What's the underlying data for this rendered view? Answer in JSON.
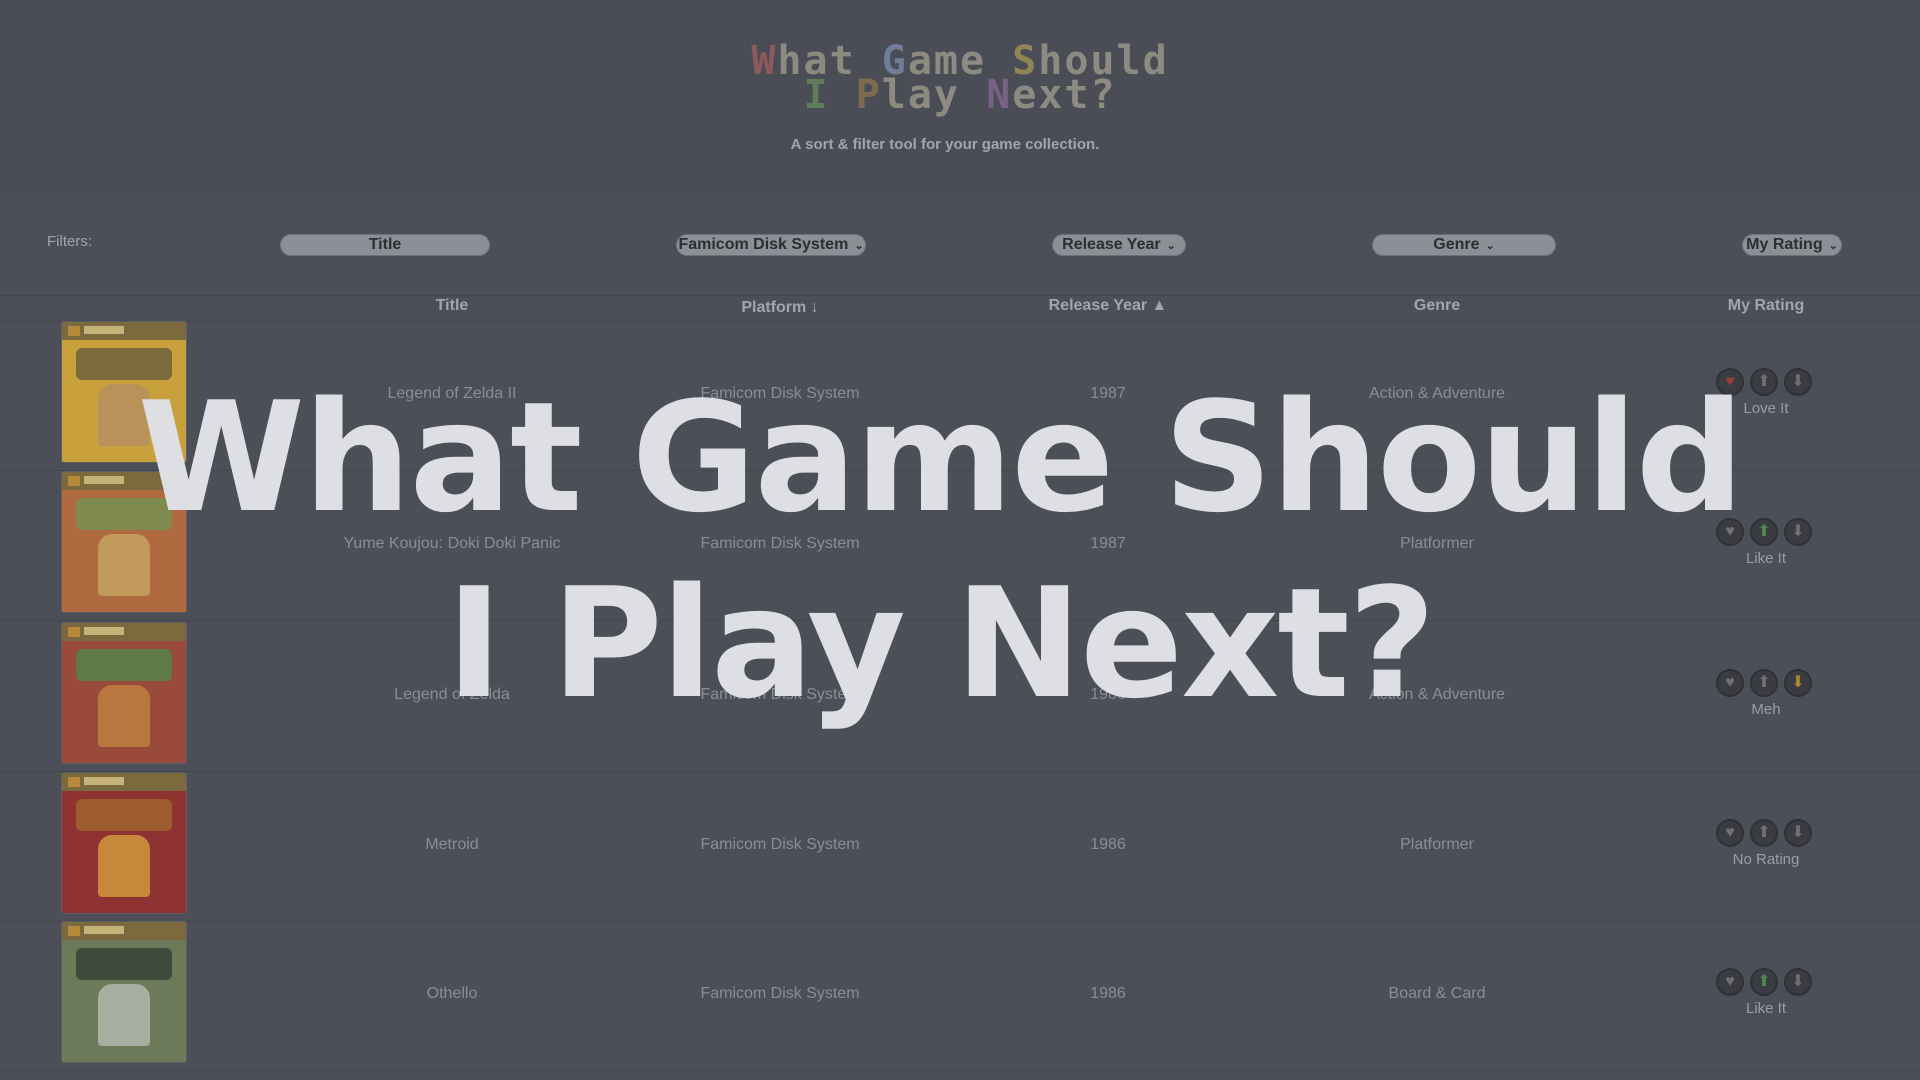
{
  "header": {
    "title_parts": [
      "W",
      "hat ",
      "G",
      "ame ",
      "S",
      "hould"
    ],
    "title_parts2": [
      "I",
      " ",
      "P",
      "lay ",
      "N",
      "ext?"
    ],
    "subtitle": "A sort & filter tool for your game collection."
  },
  "filters": {
    "label": "Filters:",
    "title": "Title",
    "platform": "Famicom Disk System",
    "release_year": "Release Year",
    "genre": "Genre",
    "my_rating": "My Rating"
  },
  "table": {
    "columns": [
      "Title",
      "Platform ↓",
      "Release Year ▲",
      "Genre",
      "My Rating"
    ],
    "rows": [
      {
        "title": "Legend of Zelda II",
        "platform": "Famicom Disk System",
        "year": "1987",
        "genre": "Action & Adventure",
        "rating": "Love It",
        "active": "love",
        "cover_colors": [
          "#c9a13c",
          "#7c6b3a",
          "#b9925a"
        ]
      },
      {
        "title": "Yume Koujou: Doki Doki Panic",
        "platform": "Famicom Disk System",
        "year": "1987",
        "genre": "Platformer",
        "rating": "Like It",
        "active": "like",
        "cover_colors": [
          "#b06a3f",
          "#7f8a4e",
          "#c29a5b"
        ]
      },
      {
        "title": "Legend of Zelda",
        "platform": "Famicom Disk System",
        "year": "1986",
        "genre": "Action & Adventure",
        "rating": "Meh",
        "active": "meh",
        "cover_colors": [
          "#9a4a3a",
          "#5e7a45",
          "#b8773c"
        ]
      },
      {
        "title": "Metroid",
        "platform": "Famicom Disk System",
        "year": "1986",
        "genre": "Platformer",
        "rating": "No Rating",
        "active": "none",
        "cover_colors": [
          "#8e3332",
          "#9c5c2d",
          "#c6893a"
        ]
      },
      {
        "title": "Othello",
        "platform": "Famicom Disk System",
        "year": "1986",
        "genre": "Board & Card",
        "rating": "Like It",
        "active": "like",
        "cover_colors": [
          "#6c7a5a",
          "#3f4a3a",
          "#a8aea0"
        ]
      }
    ]
  },
  "overlay": {
    "line1": "What Game Should",
    "line2": "I Play Next?"
  },
  "icons": {
    "love": "heart-icon",
    "like": "thumbs-up-icon",
    "meh": "thumbs-down-icon"
  }
}
